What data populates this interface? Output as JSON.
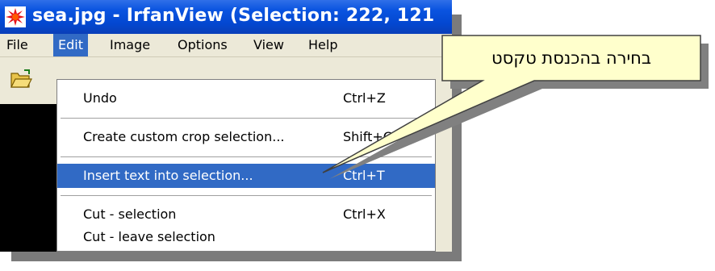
{
  "window": {
    "title": "sea.jpg - IrfanView (Selection: 222, 121"
  },
  "menubar": {
    "items": [
      "File",
      "Edit",
      "Image",
      "Options",
      "View",
      "Help"
    ],
    "active": "Edit"
  },
  "edit_menu": {
    "undo": {
      "label": "Undo",
      "shortcut": "Ctrl+Z"
    },
    "custom_crop": {
      "label": "Create custom crop selection...",
      "shortcut": "Shift+C"
    },
    "insert_text": {
      "label": "Insert text into selection...",
      "shortcut": "Ctrl+T"
    },
    "cut_selection": {
      "label": "Cut - selection",
      "shortcut": "Ctrl+X"
    },
    "cut_leave": {
      "label": "Cut - leave selection",
      "shortcut": ""
    }
  },
  "callout": {
    "text": "בחירה בהכנסת טקסט"
  },
  "colors": {
    "title_blue": "#0347d0",
    "highlight": "#316ac5",
    "callout_fill": "#ffffcc",
    "shadow": "#7b7b7b"
  },
  "icons": [
    "irfanview-app-icon",
    "open-folder-icon"
  ]
}
